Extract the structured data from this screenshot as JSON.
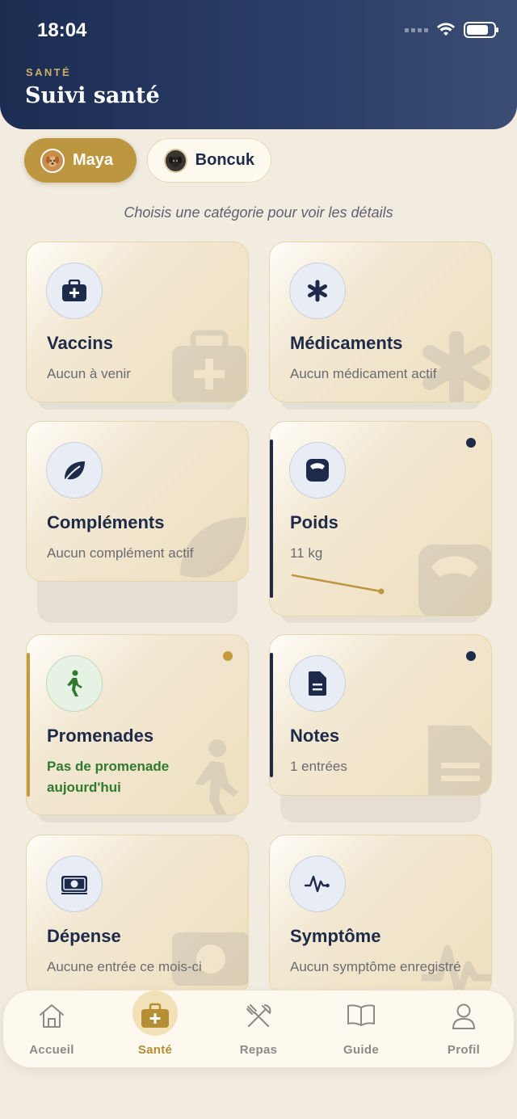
{
  "status_bar": {
    "time": "18:04"
  },
  "header": {
    "eyebrow": "SANTÉ",
    "title": "Suivi santé"
  },
  "pets": [
    {
      "name": "Maya",
      "selected": true
    },
    {
      "name": "Boncuk",
      "selected": false
    }
  ],
  "hint": "Choisis une catégorie pour voir les détails",
  "cards": {
    "vaccins": {
      "title": "Vaccins",
      "subtitle": "Aucun à venir",
      "icon": "medical-kit-icon"
    },
    "medicaments": {
      "title": "Médicaments",
      "subtitle": "Aucun médicament actif",
      "icon": "asterisk-icon"
    },
    "complements": {
      "title": "Compléments",
      "subtitle": "Aucun complément actif",
      "icon": "leaf-icon"
    },
    "poids": {
      "title": "Poids",
      "subtitle": "11 kg",
      "icon": "scale-icon",
      "accent": "#1e2a4a",
      "indicator": "#1e2a4a"
    },
    "promenades": {
      "title": "Promenades",
      "subtitle": "Pas de promenade aujourd'hui",
      "icon": "walk-icon",
      "accent": "#c49a3c",
      "indicator": "#c49a3c",
      "subtitle_color": "#2f7a2f"
    },
    "notes": {
      "title": "Notes",
      "subtitle": "1 entrées",
      "icon": "document-icon",
      "accent": "#1e2a4a",
      "indicator": "#1e2a4a"
    },
    "depense": {
      "title": "Dépense",
      "subtitle": "Aucune entrée ce mois-ci",
      "icon": "money-icon"
    },
    "symptome": {
      "title": "Symptôme",
      "subtitle": "Aucun symptôme enregistré",
      "icon": "pulse-icon"
    }
  },
  "tabbar": {
    "accueil": "Accueil",
    "sante": "Santé",
    "repas": "Repas",
    "guide": "Guide",
    "profil": "Profil",
    "active": "sante"
  },
  "colors": {
    "navy": "#1e2a4a",
    "gold": "#bd9740",
    "background": "#f1ebe0"
  }
}
